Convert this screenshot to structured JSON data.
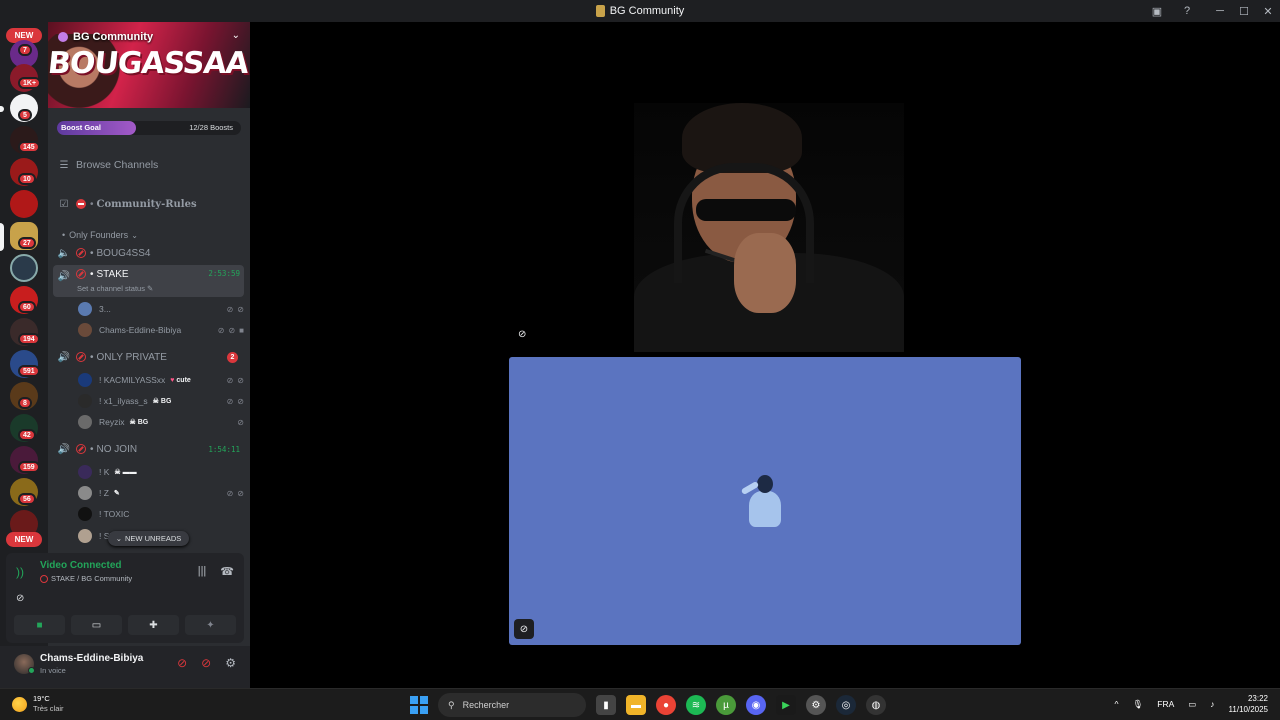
{
  "window": {
    "title": "BG Community",
    "controls": [
      "minimize",
      "maximize",
      "close"
    ]
  },
  "rail": {
    "new_label_top": "NEW",
    "new_label_bottom": "NEW",
    "badges": [
      "7",
      "1K+",
      "5",
      "145",
      "10",
      "27",
      "60",
      "194",
      "591",
      "8",
      "42",
      "159",
      "56"
    ]
  },
  "server": {
    "name": "BG Community",
    "banner_text": "BOUGASSAA",
    "boost": {
      "label": "Boost Goal",
      "count": "12/28 Boosts",
      "progress": 0.43
    }
  },
  "channels": {
    "browse": "Browse Channels",
    "rules": "Community-Rules",
    "category": "Only Founders",
    "voice": [
      {
        "name": "BOUG4SS4"
      },
      {
        "name": "STAKE",
        "timer": "2:53:59",
        "status": "Set a channel status"
      },
      {
        "name": "ONLY PRIVATE",
        "badge": "2"
      },
      {
        "name": "NO JOIN",
        "timer": "1:54:11"
      }
    ],
    "stake_members": [
      "3...",
      "Chams-Eddine-Bibiya"
    ],
    "private_members": [
      {
        "name": "! KACMILYASSxx",
        "tag": "cute"
      },
      {
        "name": "! x1_ilyass_s",
        "tag": "BG"
      },
      {
        "name": "Reyzix",
        "tag": "BG"
      }
    ],
    "nojoin_members": [
      "! K",
      "! Z",
      "! TOXIC",
      "! Sl"
    ],
    "new_unreads": "NEW UNREADS"
  },
  "voice_panel": {
    "title": "Video Connected",
    "subtitle": "STAKE / BG Community"
  },
  "user": {
    "name": "Chams-Eddine-Bibiya",
    "status": "In voice"
  },
  "taskbar": {
    "weather_temp": "19°C",
    "weather_desc": "Très clair",
    "search_placeholder": "Rechercher",
    "lang": "FRA",
    "time": "23:22",
    "date": "11/10/2025"
  },
  "colors": {
    "accent_green": "#23a55a",
    "danger_red": "#da373c",
    "tile_blue": "#5b74c0",
    "boost_purple": "#a35ac8"
  }
}
